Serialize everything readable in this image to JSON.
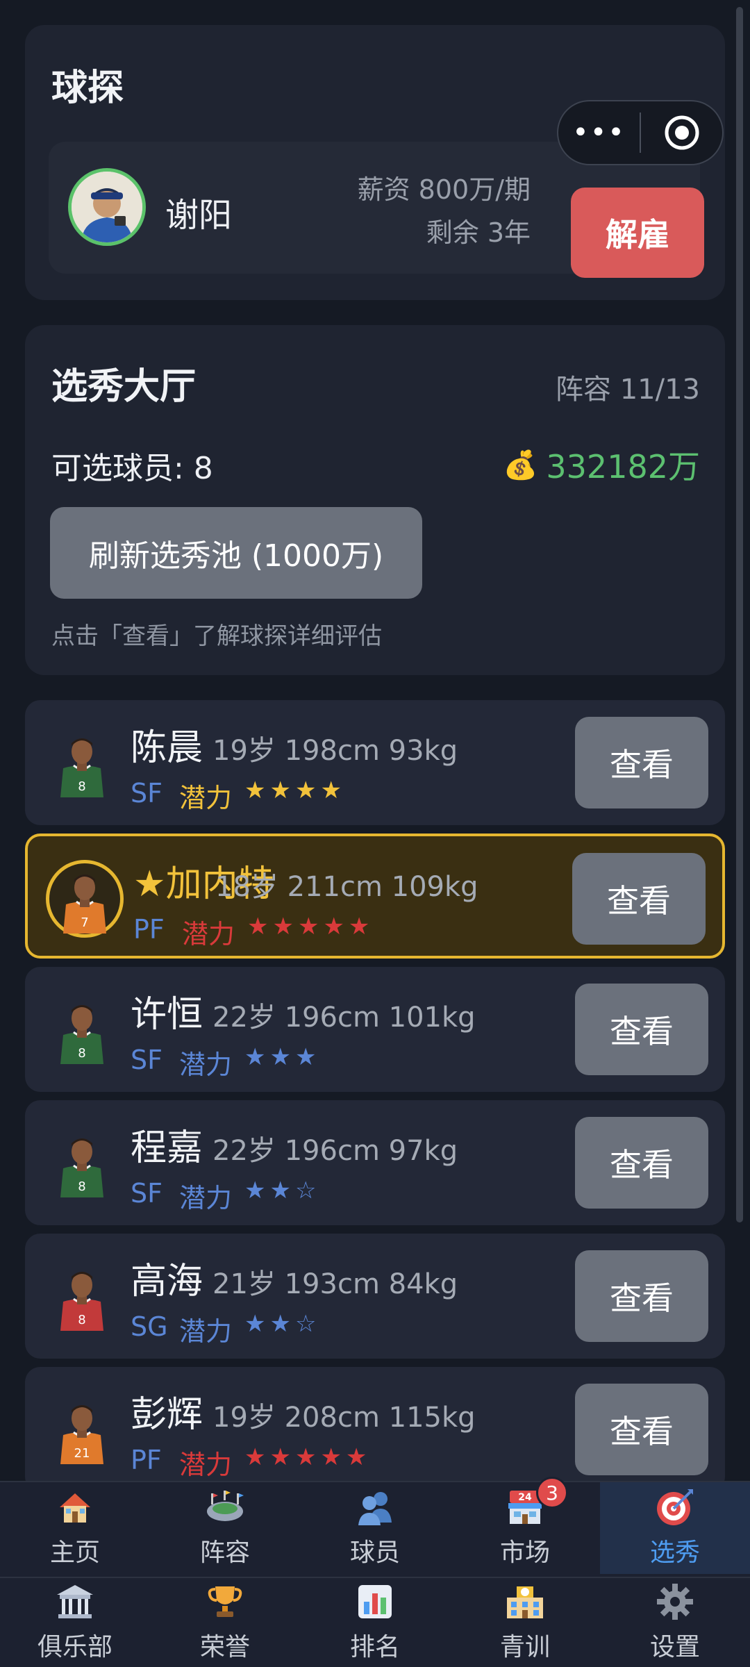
{
  "scout": {
    "title": "球探",
    "name": "谢阳",
    "salary": "薪资 800万/期",
    "remaining": "剩余 3年",
    "fire_label": "解雇"
  },
  "draft_hall": {
    "title": "选秀大厅",
    "lineup": "阵容 11/13",
    "available": "可选球员: 8",
    "money": "332182万",
    "refresh_label": "刷新选秀池 (1000万)",
    "hint": "点击「查看」了解球探详细评估"
  },
  "players": [
    {
      "name": "陈晨",
      "info": "19岁 198cm 93kg",
      "pos": "SF",
      "potential_label": "潜力",
      "stars": "★★★★",
      "potential_color": "#f2c23b",
      "featured": false,
      "view_label": "查看",
      "jersey": "8",
      "jersey_color": "#2f6a3c"
    },
    {
      "name": "★加内特",
      "info": "18岁 211cm 109kg",
      "pos": "PF",
      "potential_label": "潜力",
      "stars": "★★★★★",
      "potential_color": "#d93a3a",
      "featured": true,
      "view_label": "查看",
      "jersey": "7",
      "jersey_color": "#e07a2c"
    },
    {
      "name": "许恒",
      "info": "22岁 196cm 101kg",
      "pos": "SF",
      "potential_label": "潜力",
      "stars": "★★★",
      "potential_color": "#5b86d6",
      "featured": false,
      "view_label": "查看",
      "jersey": "8",
      "jersey_color": "#2f6a3c"
    },
    {
      "name": "程嘉",
      "info": "22岁 196cm 97kg",
      "pos": "SF",
      "potential_label": "潜力",
      "stars": "★★☆",
      "potential_color": "#5b86d6",
      "featured": false,
      "view_label": "查看",
      "jersey": "8",
      "jersey_color": "#2f6a3c"
    },
    {
      "name": "高海",
      "info": "21岁 193cm 84kg",
      "pos": "SG",
      "potential_label": "潜力",
      "stars": "★★☆",
      "potential_color": "#5b86d6",
      "featured": false,
      "view_label": "查看",
      "jersey": "8",
      "jersey_color": "#c23a3a"
    },
    {
      "name": "彭辉",
      "info": "19岁 208cm 115kg",
      "pos": "PF",
      "potential_label": "潜力",
      "stars": "★★★★★",
      "potential_color": "#d93a3a",
      "featured": false,
      "view_label": "查看",
      "jersey": "21",
      "jersey_color": "#e07a2c"
    }
  ],
  "nav": {
    "row1": [
      {
        "label": "主页",
        "icon": "house-icon"
      },
      {
        "label": "阵容",
        "icon": "stadium-icon"
      },
      {
        "label": "球员",
        "icon": "users-icon"
      },
      {
        "label": "市场",
        "icon": "store-icon",
        "badge": "3"
      },
      {
        "label": "选秀",
        "icon": "target-icon",
        "active": true
      }
    ],
    "row2": [
      {
        "label": "俱乐部",
        "icon": "club-building-icon"
      },
      {
        "label": "荣誉",
        "icon": "trophy-icon"
      },
      {
        "label": "排名",
        "icon": "bar-chart-icon"
      },
      {
        "label": "青训",
        "icon": "school-icon"
      },
      {
        "label": "设置",
        "icon": "gear-icon"
      }
    ]
  },
  "colors": {
    "accent_blue": "#4e9cf0",
    "money_green": "#5cc070",
    "fire_red": "#d95a5a",
    "featured_gold": "#e6b730"
  }
}
